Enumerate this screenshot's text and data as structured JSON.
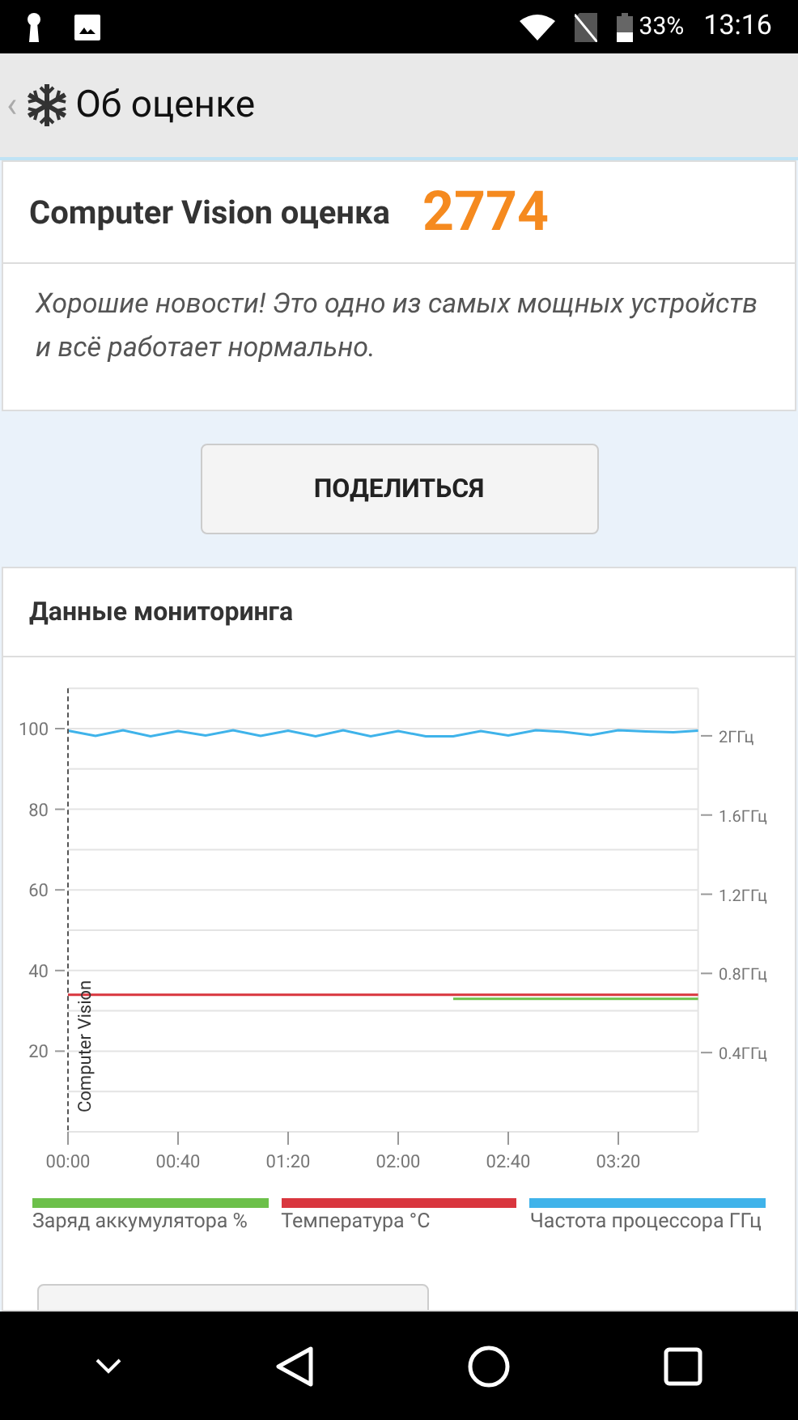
{
  "status_bar": {
    "battery": "33%",
    "time": "13:16"
  },
  "header": {
    "back": "‹",
    "title": "Об оценке"
  },
  "score_card": {
    "label": "Computer Vision оценка",
    "score": "2774",
    "message": "Хорошие новости! Это одно из самых мощных устройств и всё работает нормально."
  },
  "share_button": "ПОДЕЛИТЬСЯ",
  "monitoring": {
    "title": "Данные мониторинга",
    "chart_data": {
      "type": "line",
      "x": [
        0,
        10,
        20,
        30,
        40,
        50,
        60,
        70,
        80,
        90,
        100,
        110,
        120,
        130,
        140,
        150,
        160,
        170,
        180,
        190,
        200,
        210,
        220,
        229
      ],
      "series": [
        {
          "name": "Заряд аккумулятора %",
          "color": "#6cc04a",
          "values": [
            null,
            null,
            null,
            null,
            null,
            null,
            null,
            null,
            null,
            null,
            null,
            null,
            null,
            null,
            33,
            33,
            33,
            33,
            33,
            33,
            33,
            33,
            33,
            33
          ]
        },
        {
          "name": "Температура °C",
          "color": "#d9363e",
          "values": [
            34,
            34,
            34,
            34,
            34,
            34,
            34,
            34,
            34,
            34,
            34,
            34,
            34,
            34,
            34,
            34,
            34,
            34,
            34,
            34,
            34,
            34,
            34,
            34
          ]
        },
        {
          "name": "Частота процессора ГГц",
          "color": "#3fb3ea",
          "values": [
            99.5,
            98.2,
            99.6,
            98.1,
            99.4,
            98.3,
            99.6,
            98.2,
            99.5,
            98.1,
            99.6,
            98.1,
            99.4,
            98.1,
            98.1,
            99.4,
            98.3,
            99.6,
            99.2,
            98.4,
            99.6,
            99.3,
            99.1,
            99.5
          ]
        }
      ],
      "grid": true,
      "xlim": [
        0,
        229
      ],
      "ylim": [
        0,
        110
      ],
      "xticks": [
        {
          "value": 0,
          "label": "00:00"
        },
        {
          "value": 40,
          "label": "00:40"
        },
        {
          "value": 80,
          "label": "01:20"
        },
        {
          "value": 120,
          "label": "02:00"
        },
        {
          "value": 160,
          "label": "02:40"
        },
        {
          "value": 200,
          "label": "03:20"
        }
      ],
      "yticks": [
        20,
        40,
        60,
        80,
        100
      ],
      "y2lim": [
        0,
        2.24
      ],
      "y2ticks": [
        {
          "value": 0.4,
          "label": "0.4ГГц"
        },
        {
          "value": 0.8,
          "label": "0.8ГГц"
        },
        {
          "value": 1.2,
          "label": "1.2ГГц"
        },
        {
          "value": 1.6,
          "label": "1.6ГГц"
        },
        {
          "value": 2,
          "label": "2ГГц"
        }
      ],
      "annotations": [
        "Computer Vision"
      ]
    }
  }
}
